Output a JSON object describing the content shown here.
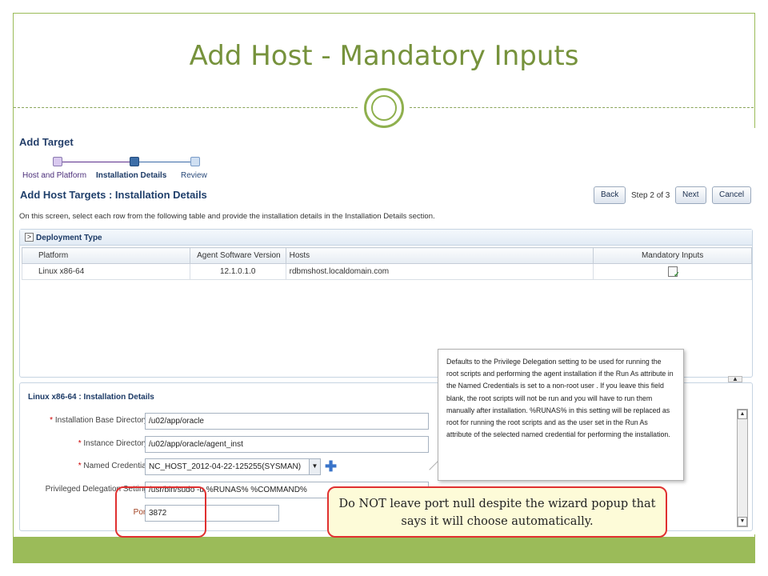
{
  "slide": {
    "title": "Add Host - Mandatory Inputs",
    "accent_color": "#9bbb59",
    "note": "Do NOT leave port null despite the wizard popup that says it will choose automatically."
  },
  "app": {
    "header_title": "Add Target",
    "train": {
      "steps": [
        "Host and Platform",
        "Installation Details",
        "Review"
      ],
      "current_index": 1
    },
    "page_heading": "Add Host Targets : Installation Details",
    "buttons": {
      "back": "Back",
      "step_text": "Step 2 of 3",
      "next": "Next",
      "cancel": "Cancel"
    },
    "instructions": "On this screen, select each row from the following table and provide the installation details in the Installation Details section.",
    "deployment": {
      "section_title": "Deployment Type",
      "toggle_glyph": ">",
      "columns": [
        "Platform",
        "Agent Software Version",
        "Hosts",
        "Mandatory Inputs"
      ],
      "rows": [
        {
          "platform": "Linux x86-64",
          "version": "12.1.0.1.0",
          "hosts": "rdbmshost.localdomain.com",
          "mandatory_icon": "document-check-icon"
        }
      ]
    },
    "details": {
      "section_title": "Linux x86-64 : Installation Details",
      "fields": {
        "base_dir": {
          "label": "Installation Base Directory",
          "value": "/u02/app/oracle",
          "required": "*"
        },
        "instance_dir": {
          "label": "Instance Directory",
          "value": "/u02/app/oracle/agent_inst",
          "required": "*"
        },
        "named_credential": {
          "label": "Named Credential",
          "value": "NC_HOST_2012-04-22-125255(SYSMAN)",
          "required": "*"
        },
        "privileged_delegation": {
          "label": "Privileged Delegation Setting",
          "value": "/usr/bin/sudo -u %RUNAS% %COMMAND%"
        },
        "port": {
          "label": "Port",
          "value": "3872"
        }
      }
    },
    "tooltip": "Defaults to the Privilege Delegation setting to be used for running the root scripts and performing the agent installation if the Run As attribute in the Named Credentials is set to a non-root user . If you leave this field blank, the root scripts will not be run and you will have to run them manually after installation. %RUNAS% in this setting will be replaced as root for running the root scripts and as the user set in the Run As attribute of the selected named credential for performing the installation."
  }
}
